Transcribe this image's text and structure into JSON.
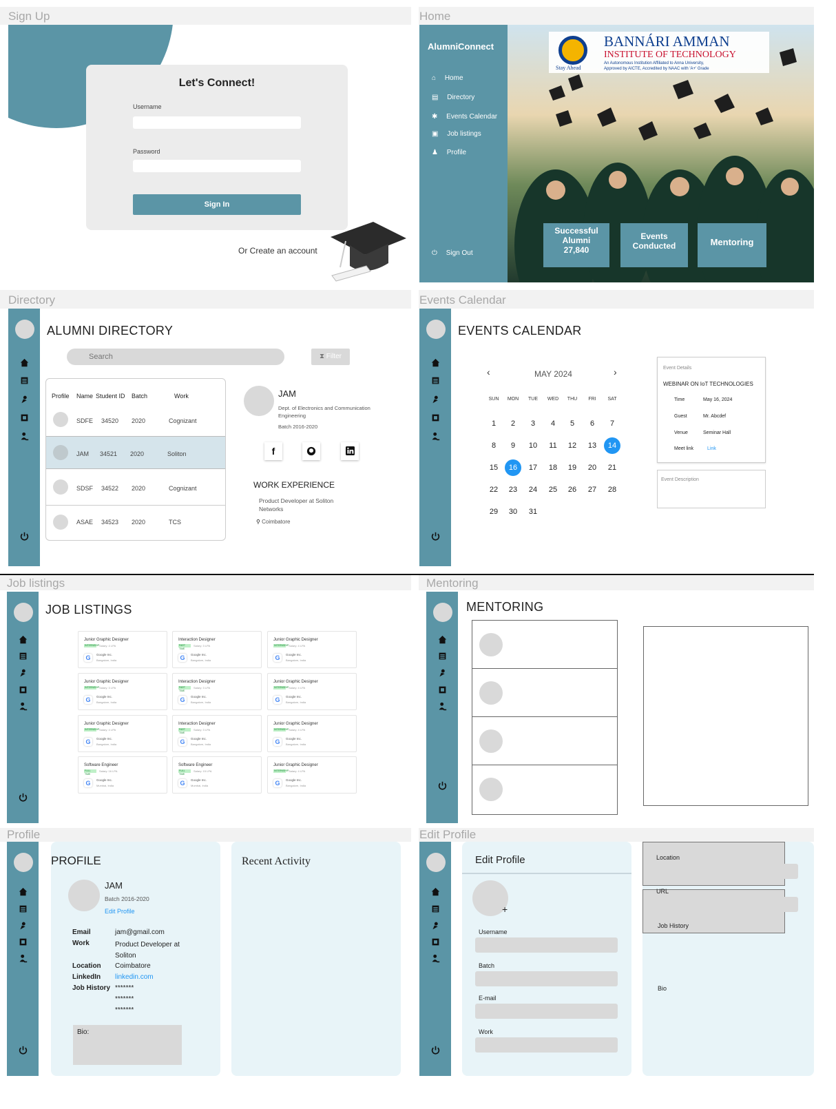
{
  "signup": {
    "frame_label": "Sign Up",
    "title": "Let's Connect!",
    "username_label": "Username",
    "password_label": "Password",
    "signin_label": "Sign In",
    "create_label": "Or Create an account"
  },
  "home": {
    "frame_label": "Home",
    "brand": "AlumniConnect",
    "nav": [
      "Home",
      "Directory",
      "Events Calendar",
      "Job listings",
      "Profile"
    ],
    "signout": "Sign Out",
    "logo_title": "BANNÁRI AMMAN",
    "logo_sub": "INSTITUTE OF TECHNOLOGY",
    "logo_line1": "An Autonomous Institution Affiliated to Anna University,",
    "logo_line2": "Approved by AICTE, Accredited by NAAC with 'A+' Grade",
    "logo_motto": "Stay Ahead",
    "stats": [
      {
        "label": "Successful Alumni",
        "value": "27,840"
      },
      {
        "label": "Events Conducted",
        "value": ""
      },
      {
        "label": "Mentoring",
        "value": ""
      }
    ]
  },
  "directory": {
    "frame_label": "Directory",
    "title": "ALUMNI DIRECTORY",
    "search_placeholder": "Search",
    "filter_label": "Filter",
    "columns": [
      "Profile",
      "Name",
      "Student ID",
      "Batch",
      "Work"
    ],
    "rows": [
      {
        "name": "SDFE",
        "id": "34520",
        "batch": "2020",
        "work": "Cognizant"
      },
      {
        "name": "JAM",
        "id": "34521",
        "batch": "2020",
        "work": "Soliton"
      },
      {
        "name": "SDSF",
        "id": "34522",
        "batch": "2020",
        "work": "Cognizant"
      },
      {
        "name": "ASAE",
        "id": "34523",
        "batch": "2020",
        "work": "TCS"
      }
    ],
    "detail": {
      "name": "JAM",
      "dept": "Dept. of Electronics and Communication Engineering",
      "batch": "Batch 2016-2020",
      "work_title": "WORK EXPERIENCE",
      "work": "Product Developer at Soliton Networks",
      "location": "Coimbatore"
    }
  },
  "events": {
    "frame_label": "Events Calendar",
    "title": "EVENTS CALENDAR",
    "month": "MAY 2024",
    "weekdays": [
      "SUN",
      "MON",
      "TUE",
      "WED",
      "THU",
      "FRI",
      "SAT"
    ],
    "weeks": [
      [
        "1",
        "2",
        "3",
        "4",
        "5",
        "6",
        "7"
      ],
      [
        "8",
        "9",
        "10",
        "11",
        "12",
        "13",
        "14"
      ],
      [
        "15",
        "16",
        "17",
        "18",
        "19",
        "20",
        "21"
      ],
      [
        "22",
        "23",
        "24",
        "25",
        "26",
        "27",
        "28"
      ],
      [
        "29",
        "30",
        "31"
      ]
    ],
    "details_title": "Event Details",
    "event_name": "WEBINAR ON IoT TECHNOLOGIES",
    "fields": [
      {
        "k": "Time",
        "v": "May 16, 2024"
      },
      {
        "k": "Guest",
        "v": "Mr. Abcdef"
      },
      {
        "k": "Venue",
        "v": "Seminar Hall"
      },
      {
        "k": "Meet link",
        "v": "Link"
      }
    ],
    "desc_title": "Event Description"
  },
  "jobs": {
    "frame_label": "Job listings",
    "title": "JOB LISTINGS",
    "cards": [
      {
        "t": "Junior Graphic Designer",
        "b": "INTERNSHIP",
        "s": "Salary: 4 LPA",
        "c": "Google Inc.",
        "l": "Bangalore, India"
      },
      {
        "t": "Interaction Designer",
        "b": "PART TIME",
        "s": "Salary: 3 LPA",
        "c": "Google Inc.",
        "l": "Bangalore, India"
      },
      {
        "t": "Junior Graphic Designer",
        "b": "INTERNSHIP",
        "s": "Salary: 4 LPA",
        "c": "Google Inc.",
        "l": "Bangalore, India"
      },
      {
        "t": "Junior Graphic Designer",
        "b": "INTERNSHIP",
        "s": "Salary: 3 LPA",
        "c": "Google Inc.",
        "l": "Bangalore, India"
      },
      {
        "t": "Interaction Designer",
        "b": "PART TIME",
        "s": "Salary: 3 LPA",
        "c": "Google Inc.",
        "l": "Bangalore, India"
      },
      {
        "t": "Junior Graphic Designer",
        "b": "INTERNSHIP",
        "s": "Salary: 4 LPA",
        "c": "Google Inc.",
        "l": "Bangalore, India"
      },
      {
        "t": "Junior Graphic Designer",
        "b": "INTERNSHIP",
        "s": "Salary: 4 LPA",
        "c": "Google Inc.",
        "l": "Bangalore, India"
      },
      {
        "t": "Interaction Designer",
        "b": "PART TIME",
        "s": "Salary: 3 LPA",
        "c": "Google Inc.",
        "l": "Bangalore, India"
      },
      {
        "t": "Junior Graphic Designer",
        "b": "INTERNSHIP",
        "s": "Salary: 4 LPA",
        "c": "Google Inc.",
        "l": "Bangalore, India"
      },
      {
        "t": "Software Engineer",
        "b": "FULL TIME",
        "s": "Salary: 16 LPA",
        "c": "Google Inc.",
        "l": "Mumbai, India"
      },
      {
        "t": "Software Engineer",
        "b": "FULL TIME",
        "s": "Salary: 15 LPA",
        "c": "Google Inc.",
        "l": "Mumbai, India"
      },
      {
        "t": "Junior Graphic Designer",
        "b": "INTERNSHIP",
        "s": "Salary: 4 LPA",
        "c": "Google Inc.",
        "l": "Bangalore, India"
      }
    ]
  },
  "mentoring": {
    "frame_label": "Mentoring",
    "title": "MENTORING"
  },
  "profile": {
    "frame_label": "Profile",
    "title": "PROFILE",
    "name": "JAM",
    "batch": "Batch 2016-2020",
    "edit_link": "Edit Profile",
    "fields": [
      {
        "k": "Email",
        "v": "jam@gmail.com"
      },
      {
        "k": "Work",
        "v": "Product Developer at Soliton"
      },
      {
        "k": "Location",
        "v": "Coimbatore"
      },
      {
        "k": "LinkedIn",
        "v": "linkedin.com"
      },
      {
        "k": "Job History",
        "v": "*******"
      }
    ],
    "history_extra": [
      "*******",
      "*******"
    ],
    "bio_label": "Bio:",
    "recent_title": "Recent Activity"
  },
  "edit_profile": {
    "frame_label": "Edit Profile",
    "title": "Edit Profile",
    "left_fields": [
      "Username",
      "Batch",
      "E-mail",
      "Work"
    ],
    "right_fields": [
      "Location",
      "URL",
      "Job History",
      "Bio"
    ]
  },
  "colors": {
    "teal": "#5b95a6",
    "accent_blue": "#2196f3",
    "panel": "#e8f4f8"
  },
  "icons": [
    "home-icon",
    "directory-icon",
    "calendar-icon",
    "jobs-icon",
    "profile-icon",
    "signout-icon"
  ]
}
